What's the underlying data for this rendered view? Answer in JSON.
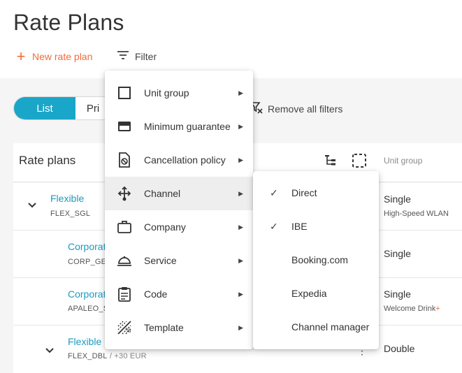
{
  "header": {
    "title": "Rate Plans",
    "new_label": "New rate plan",
    "filter_label": "Filter"
  },
  "view_toggle": {
    "active_label": "List",
    "inactive_label": "Pri"
  },
  "remove_filters_label": "Remove all filters",
  "table": {
    "title": "Rate plans",
    "unit_group_header": "Unit group",
    "rows": [
      {
        "name": "Flexible",
        "code": "FLEX_SGL",
        "unit": "Single",
        "service": "High-Speed WLAN"
      },
      {
        "name": "Corporat",
        "code": "CORP_GE",
        "unit": "Single",
        "service": ""
      },
      {
        "name": "Corporat",
        "code": "APALEO_S",
        "unit": "Single",
        "service": "Welcome Drink",
        "service_mark": "+"
      },
      {
        "name": "Flexible",
        "code": "FLEX_DBL",
        "code_suffix": "/  +30 EUR",
        "unit": "Double",
        "service": ""
      }
    ]
  },
  "filter_menu": {
    "items": [
      {
        "label": "Unit group",
        "icon": "square-icon"
      },
      {
        "label": "Minimum guarantee",
        "icon": "card-icon"
      },
      {
        "label": "Cancellation policy",
        "icon": "cancel-doc-icon"
      },
      {
        "label": "Channel",
        "icon": "channel-icon",
        "highlighted": true
      },
      {
        "label": "Company",
        "icon": "briefcase-icon"
      },
      {
        "label": "Service",
        "icon": "cloche-icon"
      },
      {
        "label": "Code",
        "icon": "clipboard-icon"
      },
      {
        "label": "Template",
        "icon": "template-icon"
      }
    ]
  },
  "channel_submenu": {
    "items": [
      {
        "label": "Direct",
        "checked": true
      },
      {
        "label": "IBE",
        "checked": true
      },
      {
        "label": "Booking.com",
        "checked": false
      },
      {
        "label": "Expedia",
        "checked": false
      },
      {
        "label": "Channel manager",
        "checked": false
      }
    ]
  },
  "colors": {
    "accent_orange": "#f26b3a",
    "accent_teal": "#1aa6c9",
    "link_blue": "#1a9bbf"
  }
}
